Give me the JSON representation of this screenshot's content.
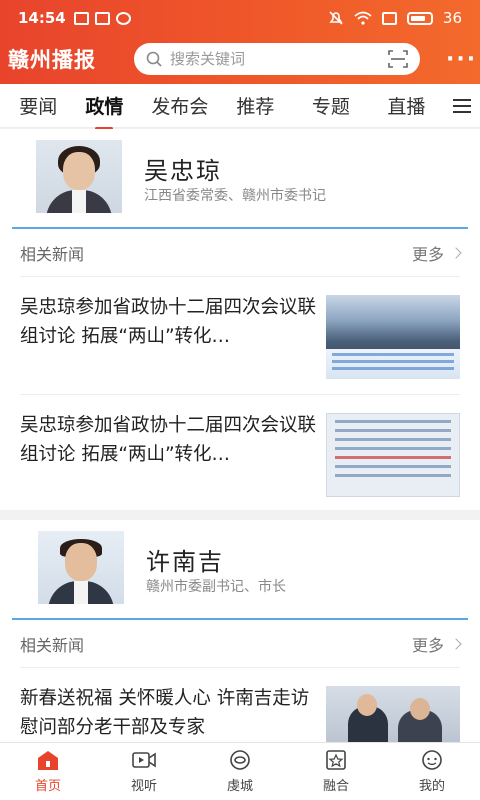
{
  "status_bar": {
    "time": "14:54",
    "battery": "36"
  },
  "header": {
    "logo": "赣州播报",
    "search_placeholder": "搜索关键词"
  },
  "tabs": [
    {
      "label": "要闻",
      "active": false
    },
    {
      "label": "政情",
      "active": true
    },
    {
      "label": "发布会",
      "active": false
    },
    {
      "label": "推荐",
      "active": false
    },
    {
      "label": "专题",
      "active": false
    },
    {
      "label": "直播",
      "active": false
    }
  ],
  "cards": [
    {
      "name": "吴忠琼",
      "title": "江西省委常委、赣州市委书记",
      "related_label": "相关新闻",
      "more_label": "更多",
      "news": [
        {
          "text": "吴忠琼参加省政协十二届四次会议联组讨论 拓展“两山”转化…"
        },
        {
          "text": "吴忠琼参加省政协十二届四次会议联组讨论 拓展“两山”转化…"
        }
      ]
    },
    {
      "name": "许南吉",
      "title": "赣州市委副书记、市长",
      "related_label": "相关新闻",
      "more_label": "更多",
      "news": [
        {
          "text": "新春送祝福 关怀暖人心 许南吉走访慰问部分老干部及专家"
        }
      ]
    }
  ],
  "bottom_nav": [
    {
      "label": "首页",
      "icon": "home-icon",
      "active": true
    },
    {
      "label": "视听",
      "icon": "video-icon",
      "active": false
    },
    {
      "label": "虔城",
      "icon": "eye-icon",
      "active": false
    },
    {
      "label": "融合",
      "icon": "star-badge-icon",
      "active": false
    },
    {
      "label": "我的",
      "icon": "chat-face-icon",
      "active": false
    }
  ],
  "colors": {
    "accent": "#e8442c",
    "card_divider": "#5aa9e0"
  }
}
